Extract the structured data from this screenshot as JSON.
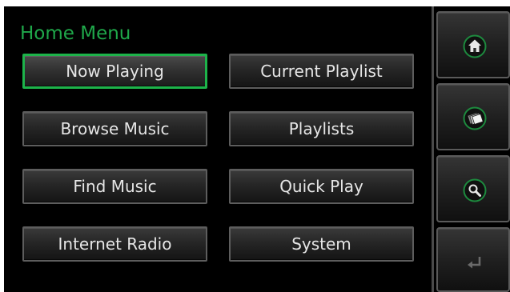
{
  "menu": {
    "title": "Home Menu",
    "items": [
      {
        "label": "Now Playing",
        "selected": true
      },
      {
        "label": "Current Playlist",
        "selected": false
      },
      {
        "label": "Browse Music",
        "selected": false
      },
      {
        "label": "Playlists",
        "selected": false
      },
      {
        "label": "Find Music",
        "selected": false
      },
      {
        "label": "Quick Play",
        "selected": false
      },
      {
        "label": "Internet Radio",
        "selected": false
      },
      {
        "label": "System",
        "selected": false
      }
    ]
  },
  "sidebar": {
    "buttons": [
      {
        "icon": "home-icon"
      },
      {
        "icon": "albums-icon"
      },
      {
        "icon": "search-icon"
      },
      {
        "icon": "back-arrow-icon"
      }
    ]
  },
  "colors": {
    "accent_green": "#1fa84a",
    "selection_border": "#1db34a",
    "background": "#000000",
    "button_text": "#e6e6e6"
  }
}
